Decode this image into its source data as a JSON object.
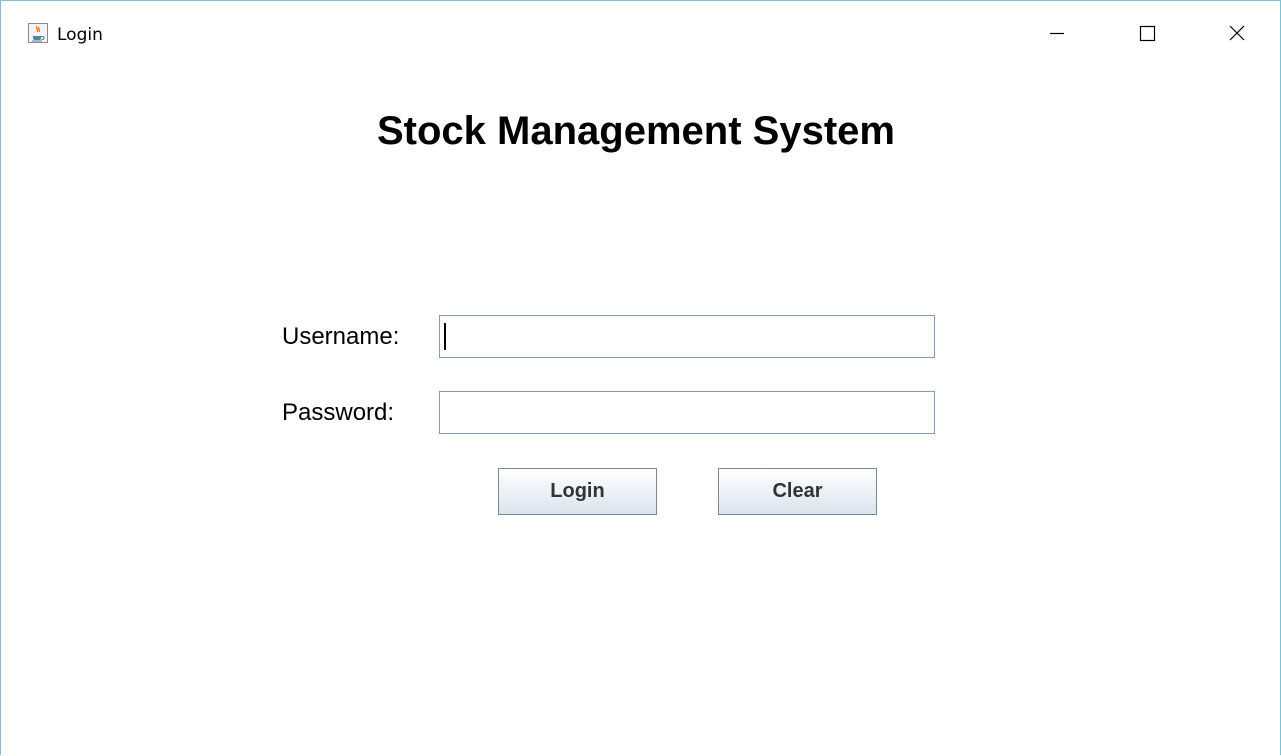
{
  "window": {
    "title": "Login",
    "icon": "java-cup-icon",
    "controls": [
      "minimize-icon",
      "maximize-icon",
      "close-icon"
    ]
  },
  "form": {
    "heading": "Stock Management System",
    "username_label": "Username:",
    "username_value": "",
    "password_label": "Password:",
    "password_value": "",
    "login_button": "Login",
    "clear_button": "Clear"
  },
  "colors": {
    "window_border": "#7ac3d6",
    "field_border": "#7f9db9",
    "button_border": "#7a8a99"
  }
}
